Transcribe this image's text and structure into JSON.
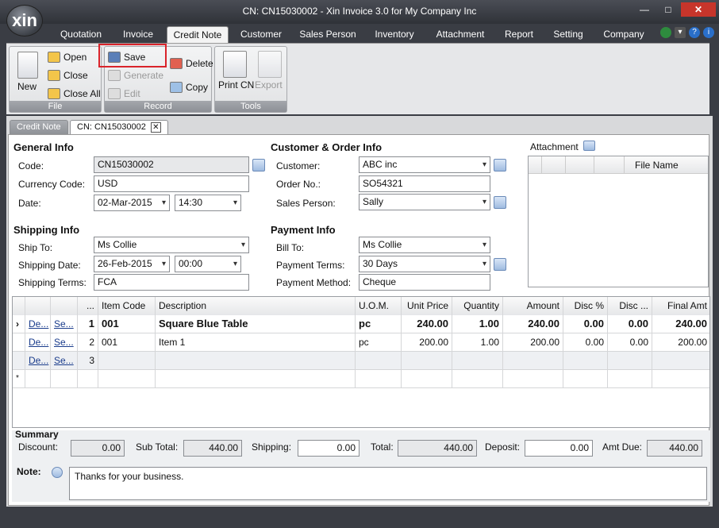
{
  "window": {
    "logo": "xin",
    "title": "CN: CN15030002 - Xin Invoice 3.0 for My Company Inc",
    "minimize": "—",
    "maximize": "□",
    "close": "✕"
  },
  "menu": {
    "tabs": [
      "Quotation",
      "Invoice",
      "Credit Note",
      "Customer",
      "Sales Person",
      "Inventory",
      "Attachment",
      "Report",
      "Setting",
      "Company"
    ],
    "active": "Credit Note"
  },
  "ribbon": {
    "file": {
      "label": "File",
      "new": "New",
      "open": "Open",
      "close": "Close",
      "close_all": "Close All"
    },
    "record": {
      "label": "Record",
      "save": "Save",
      "delete": "Delete",
      "generate": "Generate",
      "edit": "Edit",
      "copy": "Copy"
    },
    "tools": {
      "label": "Tools",
      "print": "Print CN",
      "export": "Export"
    }
  },
  "doc_tabs": {
    "list": "Credit Note",
    "current": "CN: CN15030002",
    "close": "✕"
  },
  "general": {
    "title": "General Info",
    "code_label": "Code:",
    "code": "CN15030002",
    "currency_label": "Currency Code:",
    "currency": "USD",
    "date_label": "Date:",
    "date": "02-Mar-2015",
    "time": "14:30"
  },
  "customer": {
    "title": "Customer & Order Info",
    "customer_label": "Customer:",
    "customer": "ABC inc",
    "order_label": "Order No.:",
    "order": "SO54321",
    "sales_label": "Sales Person:",
    "sales": "Sally"
  },
  "shipping": {
    "title": "Shipping Info",
    "ship_to_label": "Ship To:",
    "ship_to": "Ms Collie",
    "date_label": "Shipping Date:",
    "date": "26-Feb-2015",
    "time": "00:00",
    "terms_label": "Shipping Terms:",
    "terms": "FCA"
  },
  "payment": {
    "title": "Payment Info",
    "bill_label": "Bill To:",
    "bill": "Ms Collie",
    "terms_label": "Payment Terms:",
    "terms": "30 Days",
    "method_label": "Payment Method:",
    "method": "Cheque"
  },
  "attachment": {
    "title": "Attachment",
    "col_file": "File Name"
  },
  "grid": {
    "headers": {
      "num": "...",
      "code": "Item Code",
      "desc": "Description",
      "uom": "U.O.M.",
      "price": "Unit Price",
      "qty": "Quantity",
      "amount": "Amount",
      "disc_pct": "Disc %",
      "disc": "Disc ...",
      "final": "Final Amt"
    },
    "rows": [
      {
        "marker": "›",
        "del": "De...",
        "sel": "Se...",
        "num": "1",
        "code": "001",
        "desc": "Square Blue Table",
        "uom": "pc",
        "price": "240.00",
        "qty": "1.00",
        "amount": "240.00",
        "disc_pct": "0.00",
        "disc": "0.00",
        "final": "240.00"
      },
      {
        "marker": "",
        "del": "De...",
        "sel": "Se...",
        "num": "2",
        "code": "001",
        "desc": "Item 1",
        "uom": "pc",
        "price": "200.00",
        "qty": "1.00",
        "amount": "200.00",
        "disc_pct": "0.00",
        "disc": "0.00",
        "final": "200.00"
      },
      {
        "marker": "",
        "del": "De...",
        "sel": "Se...",
        "num": "3",
        "code": "",
        "desc": "",
        "uom": "",
        "price": "",
        "qty": "",
        "amount": "",
        "disc_pct": "",
        "disc": "",
        "final": ""
      },
      {
        "marker": "*",
        "del": "",
        "sel": "",
        "num": "",
        "code": "",
        "desc": "",
        "uom": "",
        "price": "",
        "qty": "",
        "amount": "",
        "disc_pct": "",
        "disc": "",
        "final": ""
      }
    ]
  },
  "summary": {
    "title": "Summary",
    "discount_label": "Discount:",
    "discount": "0.00",
    "subtotal_label": "Sub Total:",
    "subtotal": "440.00",
    "shipping_label": "Shipping:",
    "shipping": "0.00",
    "total_label": "Total:",
    "total": "440.00",
    "deposit_label": "Deposit:",
    "deposit": "0.00",
    "amt_due_label": "Amt Due:",
    "amt_due": "440.00",
    "note_label": "Note:",
    "note": "Thanks for your business."
  }
}
